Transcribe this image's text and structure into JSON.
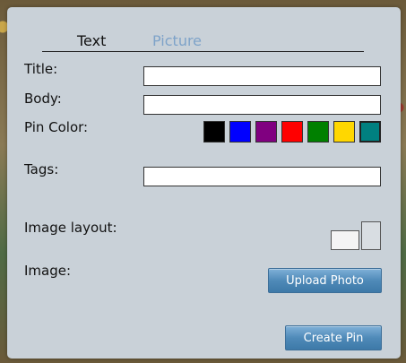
{
  "tabs": {
    "text_label": "Text",
    "picture_label": "Picture"
  },
  "form": {
    "title_label": "Title:",
    "body_label": "Body:",
    "pin_color_label": "Pin Color:",
    "tags_label": "Tags:",
    "image_layout_label": "Image layout:",
    "image_label": "Image:",
    "title_value": "",
    "body_value": "",
    "tags_value": ""
  },
  "pin_colors": [
    {
      "name": "black",
      "hex": "#000000"
    },
    {
      "name": "blue",
      "hex": "#0000ff"
    },
    {
      "name": "purple",
      "hex": "#800080"
    },
    {
      "name": "red",
      "hex": "#ff0000"
    },
    {
      "name": "green",
      "hex": "#008000"
    },
    {
      "name": "yellow",
      "hex": "#ffd700"
    },
    {
      "name": "teal",
      "hex": "#008080",
      "selected": true
    }
  ],
  "buttons": {
    "upload_label": "Upload Photo",
    "create_label": "Create Pin"
  },
  "colors": {
    "dialog_bg": "#c9d1d8",
    "tab_active": "#111111",
    "tab_inactive": "#7ea3c9",
    "button_bg": "#4f8ab8"
  }
}
